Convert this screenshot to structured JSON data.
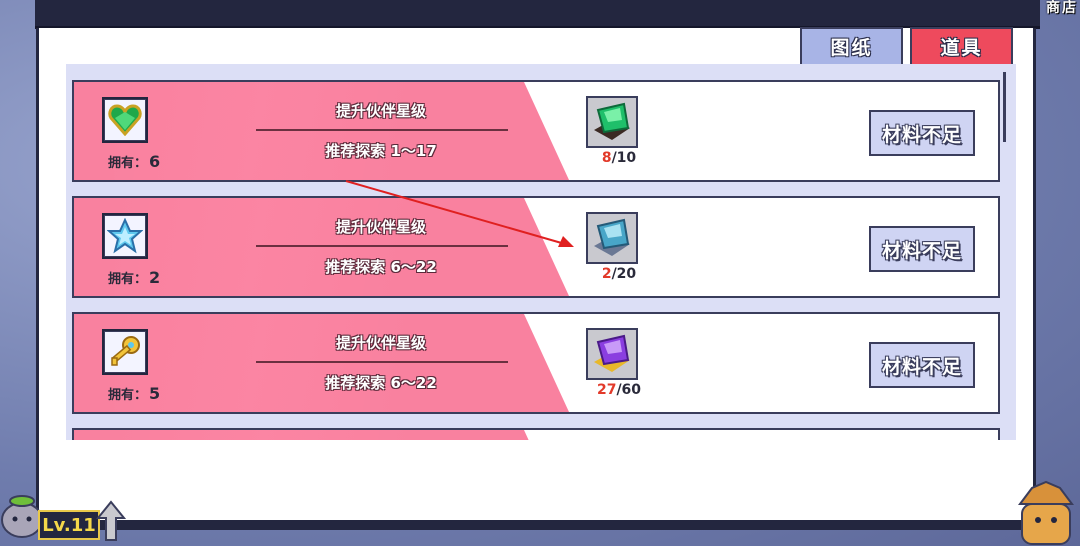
{
  "window": {
    "shop_title": "商店"
  },
  "tabs": [
    {
      "label": "图纸",
      "active": false
    },
    {
      "label": "道具",
      "active": true
    }
  ],
  "owned_label": "拥有：",
  "items": [
    {
      "icon": "green-heart-gem-icon",
      "owned": "6",
      "title": "提升伙伴星级",
      "recommend": "推荐探索 1～17",
      "material_icon": "green-crystal-shard-icon",
      "have": "8",
      "need": "/10",
      "button": "材料不足"
    },
    {
      "icon": "blue-star-crystal-icon",
      "owned": "2",
      "title": "提升伙伴星级",
      "recommend": "推荐探索 6～22",
      "material_icon": "blue-crystal-shard-icon",
      "have": "2",
      "need": "/20",
      "button": "材料不足"
    },
    {
      "icon": "golden-key-icon",
      "owned": "5",
      "title": "提升伙伴星级",
      "recommend": "推荐探索 6～22",
      "material_icon": "purple-crystal-shard-icon",
      "have": "27",
      "need": "/60",
      "button": "材料不足"
    }
  ],
  "player": {
    "level": "Lv.11"
  },
  "colors": {
    "card_pink": "#f9819f",
    "tab_active": "#ee4a5d",
    "tab_inactive": "#a8b4e6",
    "frame": "#23263f"
  }
}
